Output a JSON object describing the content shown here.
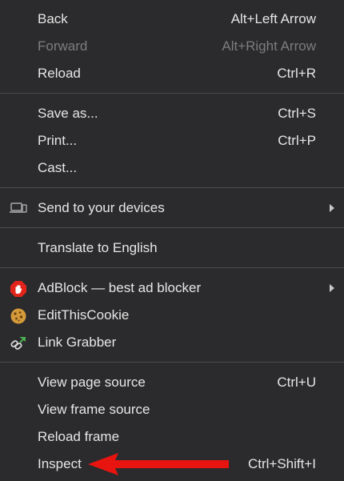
{
  "menu": {
    "groups": [
      [
        {
          "label": "Back",
          "shortcut": "Alt+Left Arrow",
          "disabled": false
        },
        {
          "label": "Forward",
          "shortcut": "Alt+Right Arrow",
          "disabled": true
        },
        {
          "label": "Reload",
          "shortcut": "Ctrl+R",
          "disabled": false
        }
      ],
      [
        {
          "label": "Save as...",
          "shortcut": "Ctrl+S",
          "disabled": false
        },
        {
          "label": "Print...",
          "shortcut": "Ctrl+P",
          "disabled": false
        },
        {
          "label": "Cast...",
          "shortcut": "",
          "disabled": false
        }
      ],
      [
        {
          "label": "Send to your devices",
          "icon": "devices-icon",
          "submenu": true
        }
      ],
      [
        {
          "label": "Translate to English"
        }
      ],
      [
        {
          "label": "AdBlock — best ad blocker",
          "icon": "adblock-icon",
          "submenu": true
        },
        {
          "label": "EditThisCookie",
          "icon": "cookie-icon"
        },
        {
          "label": "Link Grabber",
          "icon": "link-grabber-icon"
        }
      ],
      [
        {
          "label": "View page source",
          "shortcut": "Ctrl+U"
        },
        {
          "label": "View frame source",
          "shortcut": ""
        },
        {
          "label": "Reload frame",
          "shortcut": ""
        },
        {
          "label": "Inspect",
          "shortcut": "Ctrl+Shift+I"
        }
      ]
    ]
  },
  "annotation": {
    "type": "red-arrow",
    "target": "Inspect",
    "color": "#e8140f"
  },
  "colors": {
    "menu_background": "#2b2b2d",
    "text": "#e6e6e6",
    "disabled_text": "#7d7d7f",
    "separator": "#4a4a4c"
  }
}
